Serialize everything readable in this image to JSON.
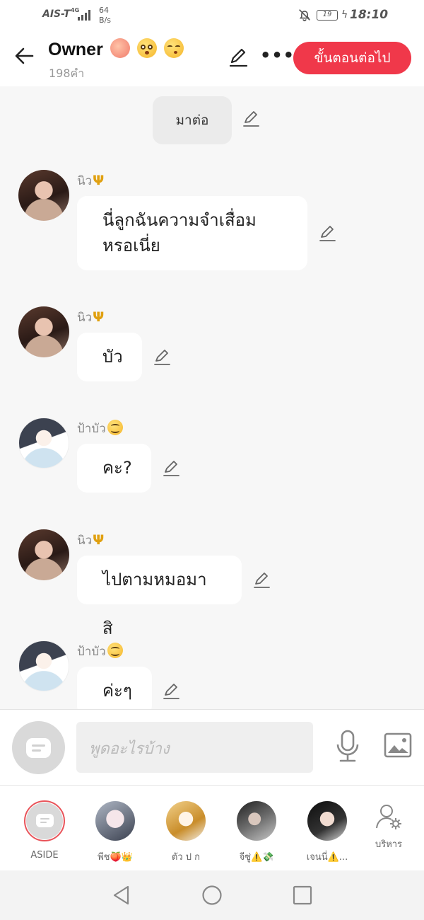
{
  "status_bar": {
    "carrier": "AIS-T",
    "network": "4G",
    "speed_value": "64",
    "speed_unit": "B/s",
    "battery": "19",
    "time": "18:10"
  },
  "header": {
    "title": "Owner",
    "title_emojis": [
      "peach-emoji",
      "flushed-face-emoji",
      "kissing-face-emoji"
    ],
    "word_count": "198คำ",
    "next_button": "ขั้นตอนต่อไป"
  },
  "chat": {
    "narration": "มาต่อ",
    "messages": [
      {
        "speaker": "นิว",
        "speaker_icon": "trident-icon",
        "avatar": "niw-avatar",
        "text": "นี่ลูกฉันความจำเสื่อม\nหรอเนี่ย"
      },
      {
        "speaker": "นิว",
        "speaker_icon": "trident-icon",
        "avatar": "niw-avatar",
        "text": "บัว"
      },
      {
        "speaker": "ป้าบัว",
        "speaker_icon": "smiling-face-icon",
        "avatar": "paabua-avatar",
        "text": "คะ?"
      },
      {
        "speaker": "นิว",
        "speaker_icon": "trident-icon",
        "avatar": "niw-avatar",
        "text": "ไปตามหมอมาสิ"
      },
      {
        "speaker": "ป้าบัว",
        "speaker_icon": "smiling-face-icon",
        "avatar": "paabua-avatar",
        "text": "ค่ะๆ"
      }
    ]
  },
  "input": {
    "placeholder": "พูดอะไรบ้าง"
  },
  "aside_bar": {
    "items": [
      {
        "label": "ASIDE"
      },
      {
        "label": "พีช🍑👑"
      },
      {
        "label": "ตัว ป ก"
      },
      {
        "label": "จีซู่⚠️💸"
      },
      {
        "label": "เจนนี่⚠️..."
      }
    ],
    "manage_label": "บริหาร"
  },
  "theme": {
    "accent": "#f0384a",
    "background": "#f7f7f7",
    "bubble": "#ffffff"
  }
}
